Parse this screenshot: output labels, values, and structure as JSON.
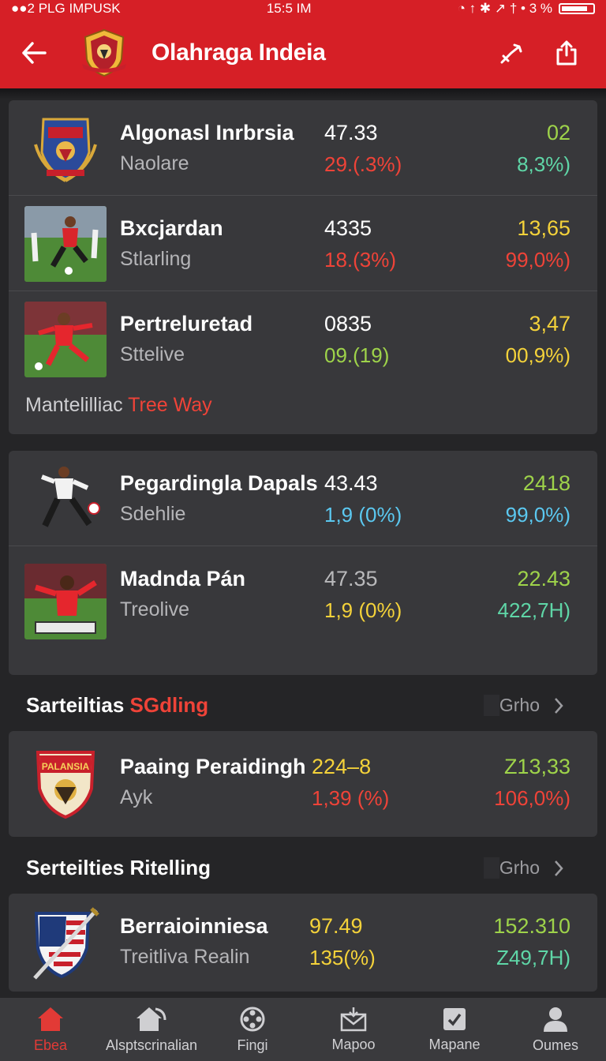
{
  "status_bar": {
    "left": "●●2 PLG IMPUSK",
    "time": "15:5 IM",
    "right": "◔ ↑ ✱ ↗ † • 3 %"
  },
  "header": {
    "title": "Olahraga Indeia",
    "back_icon": "arrow-left-icon",
    "action_icons": [
      "link-icon",
      "share-icon"
    ]
  },
  "colors": {
    "brand_red": "#d61f26",
    "white": "#ffffff",
    "red": "#ef4338",
    "yellow": "#f4d23a",
    "green": "#9ed34a",
    "teal": "#5fd6a7",
    "cyan": "#5bc8f0",
    "grey": "#b9b9bb"
  },
  "card1": {
    "rows": [
      {
        "name": "Algonasl Inrbrsia",
        "sub": "Naolare",
        "v1": "47.33",
        "v2": "29.(.3%)",
        "v3": "02",
        "v4": "8,3%)",
        "thumb": "crest-icon"
      },
      {
        "name": "Bxcjardan",
        "sub": "Stlarling",
        "v1": "4335",
        "v2": "18.(3%)",
        "v3": "13,65",
        "v4": "99,0%)",
        "thumb": "soccer-player-photo"
      },
      {
        "name": "Pertreluretad",
        "sub": "Sttelive",
        "v1": "0835",
        "v2": "09.(19)",
        "v3": "3,47",
        "v4": "00,9%)",
        "thumb": "soccer-player-photo"
      }
    ],
    "footer_white": "Mantelilliac",
    "footer_red": "Tree Way"
  },
  "card2": {
    "rows": [
      {
        "name": "Pegardingla Dapals",
        "sub": "Sdehlie",
        "v1": "43.43",
        "v2": "1,9 (0%)",
        "v3": "2418",
        "v4": "99,0%)",
        "thumb": "soccer-player-photo"
      },
      {
        "name": "Madnda Pán",
        "sub": "Treolive",
        "v1": "47.35",
        "v2": "1,9 (0%)",
        "v3": "22.43",
        "v4": "422,7H)",
        "thumb": "soccer-player-photo"
      }
    ]
  },
  "section1": {
    "title_white": "Sarteiltias",
    "title_red": "SGdling",
    "see_all": "Grho",
    "row": {
      "name": "Paaing Peraidingh",
      "sub": "Ayk",
      "v1": "224–8",
      "v2": "1,39 (%)",
      "v3": "Z13,33",
      "v4": "106,0%)",
      "thumb": "shield-crest-icon",
      "crest_text": "PALANSIA"
    }
  },
  "section2": {
    "title": "Serteilties Ritelling",
    "see_all": "Grho",
    "row": {
      "name": "Berraioinniesa",
      "sub": "Treitliva Realin",
      "v1": "97.49",
      "v2": "135(%)",
      "v3": "152.310",
      "v4": "Z49,7H)",
      "thumb": "sword-shield-crest-icon"
    }
  },
  "bottom_nav": [
    {
      "label": "Ebea",
      "icon": "home-icon",
      "active": true
    },
    {
      "label": "Alsptscrinalian",
      "icon": "house-chart-icon",
      "active": false
    },
    {
      "label": "Fingi",
      "icon": "film-reel-icon",
      "active": false
    },
    {
      "label": "Mapoo",
      "icon": "inbox-icon",
      "active": false
    },
    {
      "label": "Mapane",
      "icon": "checkbox-icon",
      "active": false
    },
    {
      "label": "Oumes",
      "icon": "user-icon",
      "active": false
    }
  ]
}
